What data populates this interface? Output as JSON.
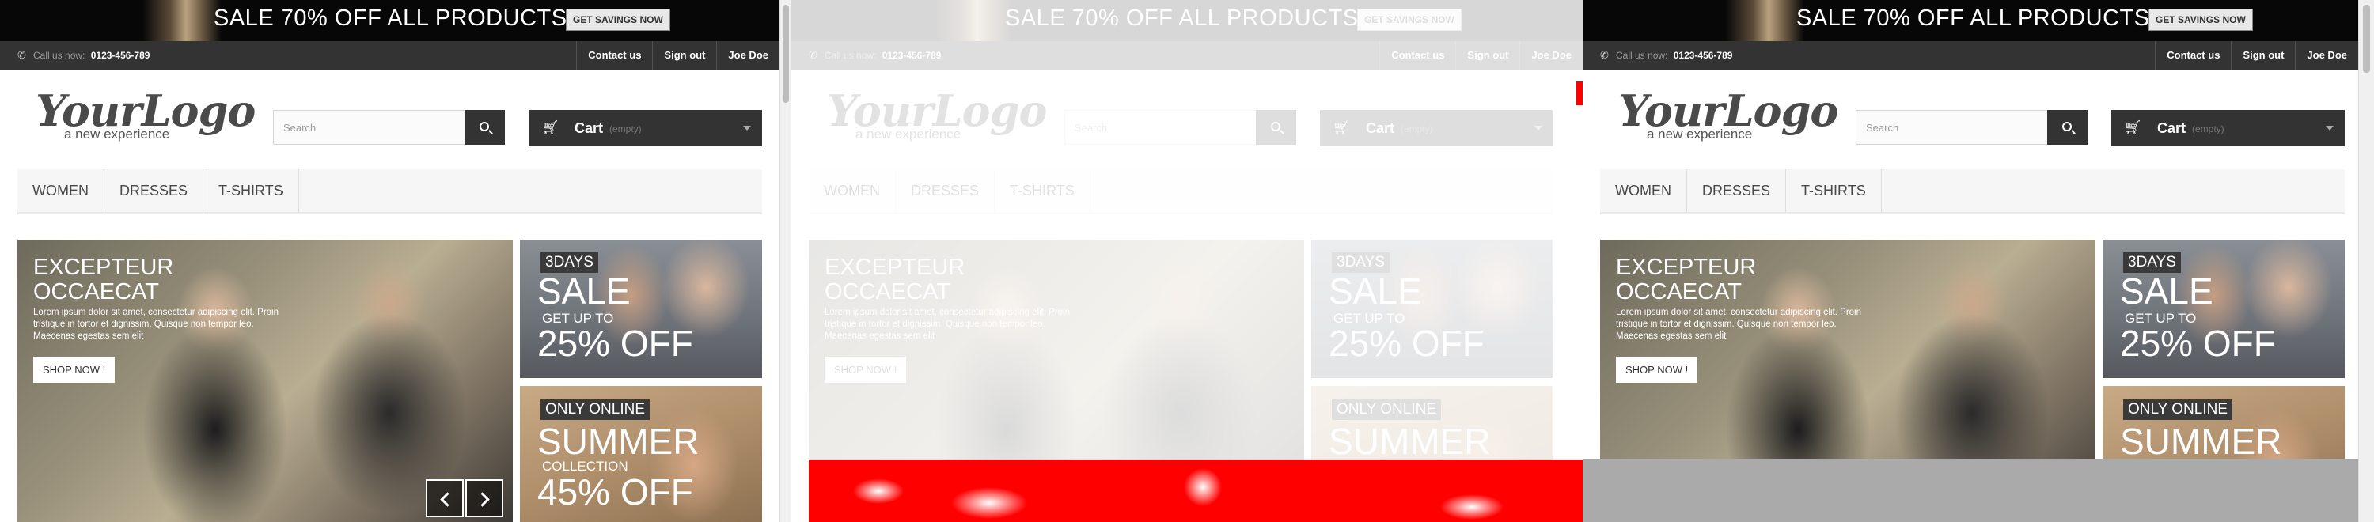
{
  "promo": {
    "text": "SALE 70% OFF ALL PRODUCTS",
    "button": "GET SAVINGS NOW"
  },
  "navbar": {
    "call_label": "Call us now:",
    "phone": "0123-456-789",
    "links": [
      "Contact us",
      "Sign out",
      "Joe Doe"
    ]
  },
  "logo": {
    "main": "YourLogo",
    "tagline": "a new experience"
  },
  "search": {
    "placeholder": "Search"
  },
  "cart": {
    "label": "Cart",
    "status": "(empty)"
  },
  "menu": {
    "items": [
      "WOMEN",
      "DRESSES",
      "T-SHIRTS"
    ]
  },
  "slider": {
    "title_line1": "EXCEPTEUR",
    "title_line2": "OCCAECAT",
    "text": "Lorem ipsum dolor sit amet, consectetur adipiscing elit. Proin tristique in tortor et dignissim. Quisque non tempor leo. Maecenas egestas sem elit",
    "button": "SHOP NOW !"
  },
  "banners": [
    {
      "tag": "3DAYS",
      "big": "SALE",
      "small": "GET UP TO",
      "pct": "25% OFF"
    },
    {
      "tag": "ONLY ONLINE",
      "big": "SUMMER",
      "small": "COLLECTION",
      "pct": "45% OFF"
    }
  ],
  "colors": {
    "promo_bg": "#070707",
    "navbar_bg": "#333333",
    "button_dark": "#333333",
    "menu_bg": "#f6f6f6",
    "diff_red": "#ff0000",
    "overlay_gray": "#aaaaaa"
  },
  "icons": {
    "phone": "phone-icon",
    "search": "search-icon",
    "cart": "cart-icon",
    "prev": "chevron-left-icon",
    "next": "chevron-right-icon"
  }
}
